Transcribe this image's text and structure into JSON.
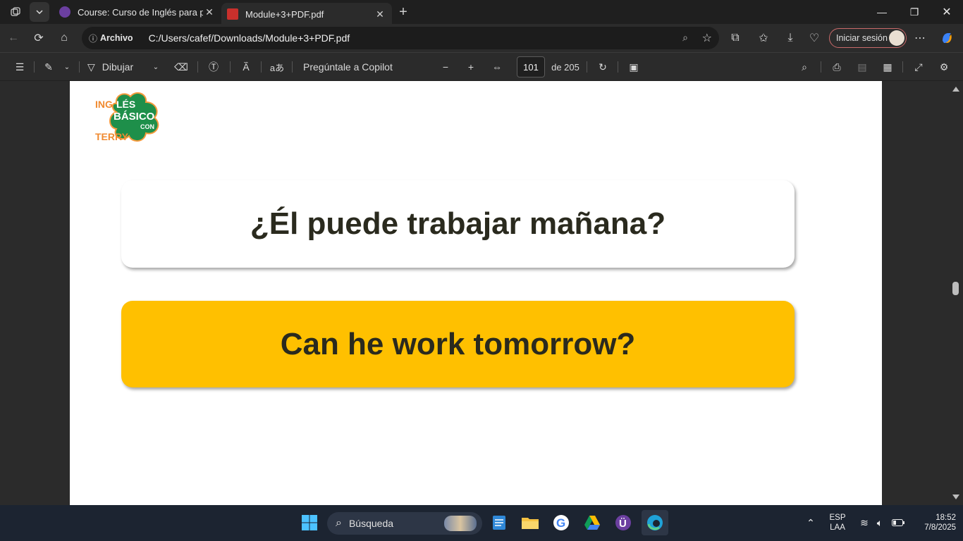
{
  "browser": {
    "tabs": [
      {
        "title": "Course: Curso de Inglés para principiantes",
        "active": false
      },
      {
        "title": "Module+3+PDF.pdf",
        "active": true
      }
    ],
    "address": {
      "source_label": "Archivo",
      "url": "C:/Users/cafef/Downloads/Module+3+PDF.pdf"
    },
    "signin_label": "Iniciar sesión"
  },
  "pdf_toolbar": {
    "draw_label": "Dibujar",
    "copilot_label": "Pregúntale a Copilot",
    "current_page": "101",
    "total_pages_label": "de 205"
  },
  "document": {
    "logo_text": {
      "top": "INGLÉS",
      "middle": "BÁSICO",
      "con": "CON",
      "bottom": "TERRY"
    },
    "question": "¿Él puede trabajar mañana?",
    "answer": "Can he work tomorrow?",
    "answer_card_color": "#ffc000"
  },
  "taskbar": {
    "search_placeholder": "Búsqueda",
    "language": "ESP",
    "layout": "LAA",
    "time": "18:52",
    "date": "7/8/2025"
  }
}
